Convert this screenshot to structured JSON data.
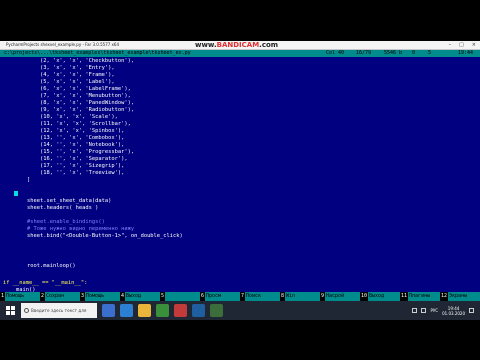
{
  "window": {
    "title": "PycharmProjects  shexvel_example.py - Far 3.0.5577 x64",
    "watermark_prefix": "www.",
    "watermark_brand": "BANDICAM",
    "watermark_suffix": ".com"
  },
  "status_line": {
    "path": "c:\\projects\\...\\tksheet_examples\\tksheet_example\\tksheet_ex.py",
    "col": "Col 40",
    "row": "16/79",
    "size": "5546 b",
    "counter": "0",
    "mode": "5",
    "time": "19:44"
  },
  "code_lines": [
    "        (2, 'x', 'x', 'Checkbutton'),",
    "        (3, 'x', 'x', 'Entry'),",
    "        (4, 'x', 'x', 'Frame'),",
    "        (5, 'x', 'x', 'Label'),",
    "        (6, 'x', 'x', 'LabelFrame'),",
    "        (7, 'x', 'x', 'Menubutton'),",
    "        (8, 'x', 'x', 'PanedWindow'),",
    "        (9, 'x', 'x', 'Radiobutton'),",
    "        (10, 'x', 'x', 'Scale'),",
    "        (11, 'x', 'x', 'Scrollbar'),",
    "        (12, 'x', 'x', 'Spinbox'),",
    "        (13, '', 'x', 'Combobox'),",
    "        (14, '', 'x', 'Notebook'),",
    "        (15, '', 'x', 'Progressbar'),",
    "        (16, '', 'x', 'Separator'),",
    "        (17, '', 'x', 'Sizegrip'),",
    "        (18, '', 'x', 'Treeview'),",
    "    ]",
    "",
    "    sheet.set_sheet_data(data)",
    "    sheet.headers( heads )",
    "",
    "    #sheet.enable_bindings()",
    "    # Тоже нужно видно переменно нижу",
    "    sheet.bind(\"<Double-Button-1>\", on_double_click)",
    "",
    "",
    "    root.mainloop()",
    "",
    "if __name__ == \"__main__\":",
    "    main()"
  ],
  "function_keys": [
    {
      "num": "1",
      "label": "Помощь"
    },
    {
      "num": "2",
      "label": "Сохран"
    },
    {
      "num": "3",
      "label": "Помощь"
    },
    {
      "num": "4",
      "label": "Выход"
    },
    {
      "num": "5",
      "label": ""
    },
    {
      "num": "6",
      "label": "Просм"
    },
    {
      "num": "7",
      "label": "Поиск"
    },
    {
      "num": "8",
      "label": "Win"
    },
    {
      "num": "9",
      "label": "Насрой"
    },
    {
      "num": "10",
      "label": "Выход"
    },
    {
      "num": "11",
      "label": "Плагины"
    },
    {
      "num": "12",
      "label": "Экраны"
    }
  ],
  "taskbar": {
    "search_placeholder": "Введите здесь текст для поиска",
    "time": "19:44",
    "date": "01.03.2020",
    "lang": "РУС",
    "accent": "#008c8c"
  }
}
